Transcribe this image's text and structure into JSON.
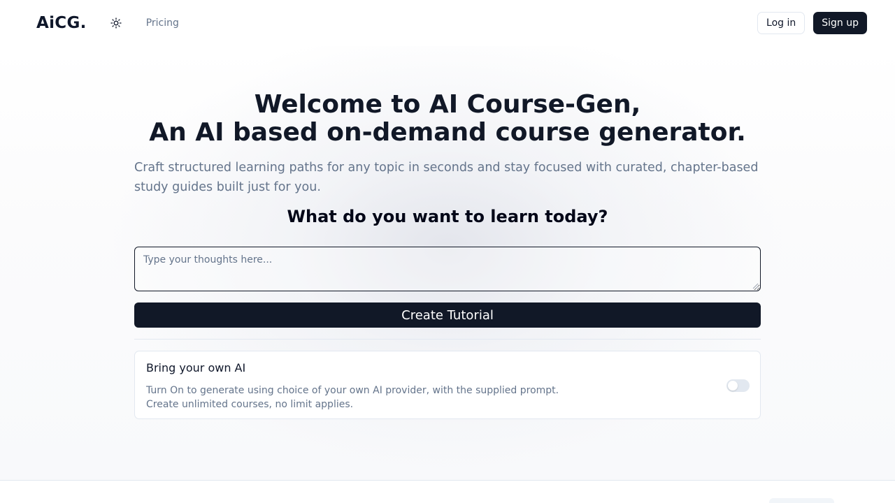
{
  "header": {
    "logo": "AiCG.",
    "theme_icon": "sun-icon",
    "nav_pricing": "Pricing",
    "login_label": "Log in",
    "signup_label": "Sign up"
  },
  "hero": {
    "title_line1": "Welcome to AI Course-Gen,",
    "title_line2": "An AI based on-demand course generator.",
    "subtitle": "Craft structured learning paths for any topic in seconds and stay focused with curated, chapter-based study guides built just for you.",
    "question": "What do you want to learn today?",
    "prompt_placeholder": "Type your thoughts here...",
    "prompt_value": "",
    "create_label": "Create Tutorial"
  },
  "byoa": {
    "title": "Bring your own AI",
    "desc_line1": "Turn On to generate using choice of your own AI provider, with the supplied prompt.",
    "desc_line2": "Create unlimited courses, no limit applies.",
    "enabled": false
  },
  "colors": {
    "primary": "#111827",
    "muted_text": "#64748b",
    "border": "#e2e8f0"
  }
}
